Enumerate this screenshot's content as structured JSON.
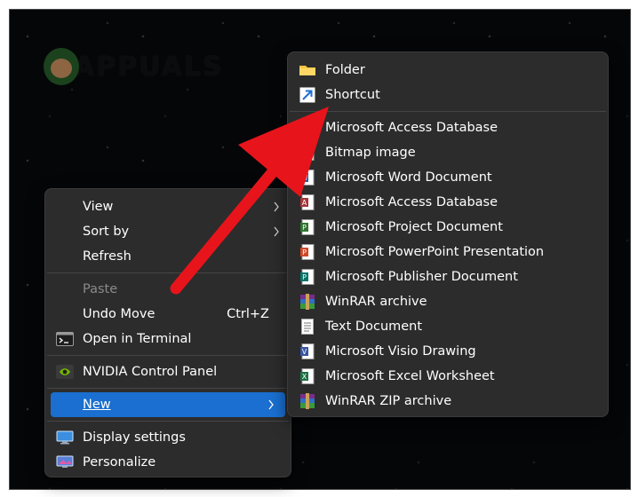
{
  "watermark": {
    "text": "APPUALS"
  },
  "context_menu": {
    "items": [
      {
        "label": "View",
        "has_submenu": true
      },
      {
        "label": "Sort by",
        "has_submenu": true
      },
      {
        "label": "Refresh"
      },
      {
        "label": "Paste",
        "disabled": true
      },
      {
        "label": "Undo Move",
        "shortcut": "Ctrl+Z"
      },
      {
        "label": "Open in Terminal",
        "icon": "terminal-icon"
      },
      {
        "label": "NVIDIA Control Panel",
        "icon": "nvidia-icon"
      },
      {
        "label": "New",
        "has_submenu": true,
        "highlighted": true
      },
      {
        "label": "Display settings",
        "icon": "display-icon"
      },
      {
        "label": "Personalize",
        "icon": "personalize-icon"
      }
    ]
  },
  "new_submenu": {
    "items": [
      {
        "label": "Folder",
        "icon": "folder-icon"
      },
      {
        "label": "Shortcut",
        "icon": "shortcut-icon"
      },
      {
        "label": "Microsoft Access Database",
        "icon": "access-icon"
      },
      {
        "label": "Bitmap image",
        "icon": "bitmap-icon"
      },
      {
        "label": "Microsoft Word Document",
        "icon": "word-icon"
      },
      {
        "label": "Microsoft Access Database",
        "icon": "access-icon"
      },
      {
        "label": "Microsoft Project Document",
        "icon": "project-icon"
      },
      {
        "label": "Microsoft PowerPoint Presentation",
        "icon": "powerpoint-icon"
      },
      {
        "label": "Microsoft Publisher Document",
        "icon": "publisher-icon"
      },
      {
        "label": "WinRAR archive",
        "icon": "winrar-icon"
      },
      {
        "label": "Text Document",
        "icon": "text-document-icon"
      },
      {
        "label": "Microsoft Visio Drawing",
        "icon": "visio-icon"
      },
      {
        "label": "Microsoft Excel Worksheet",
        "icon": "excel-icon"
      },
      {
        "label": "WinRAR ZIP archive",
        "icon": "winrar-zip-icon"
      }
    ]
  },
  "colors": {
    "menu_bg": "#2c2c2c",
    "highlight": "#1a6fd0",
    "annotation_arrow": "#e8141b"
  }
}
